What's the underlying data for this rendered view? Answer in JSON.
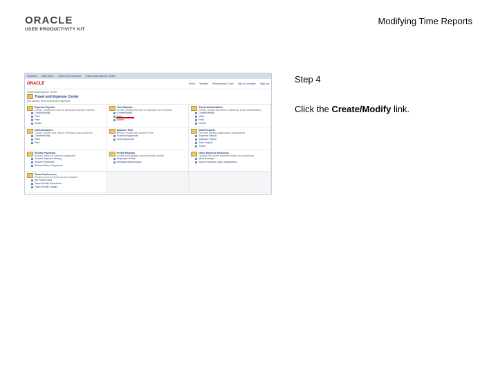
{
  "logo": {
    "brand": "ORACLE",
    "product": "USER PRODUCTIVITY KIT"
  },
  "doc_title": "Modifying Time Reports",
  "step": "Step 4",
  "instruction": {
    "prefix": "Click the ",
    "target": "Create/Modify",
    "suffix": " link."
  },
  "screenshot": {
    "topbar": [
      "Favorites",
      "Main Menu",
      "Travel and Expenses",
      "Travel and Expense Center"
    ],
    "oracle": "ORACLE",
    "nav": [
      "Home",
      "Worklist",
      "Performance Trace",
      "Add to Favorites",
      "Sign out"
    ],
    "crumb": "Travel and Expense Center",
    "center_title": "Travel and Expense Center",
    "intro": "Get started: Select and enter expenses",
    "sections": [
      {
        "name": "Expense Reports",
        "desc": "Create, modify and view or withdraw Expense Reports",
        "links": [
          "Create/Modify",
          "View",
          "Print",
          "Delete"
        ]
      },
      {
        "name": "Time Reports",
        "desc": "Create, modify and view or withdraw Time Reports",
        "links": [
          "Create/Modify",
          "View",
          "Delete"
        ]
      },
      {
        "name": "Travel Authorization",
        "desc": "Create, modify and view or withdraw Travel Authorization",
        "links": [
          "Create/Modify",
          "View",
          "Print",
          "Delete"
        ]
      },
      {
        "name": "Cash Advances",
        "desc": "Create, modify, and view or withdraw cash advances",
        "links": [
          "Create/Modify",
          "View",
          "Print"
        ]
      },
      {
        "name": "Approve Time",
        "desc": "Review, modify and approve time",
        "links": [
          "Expense Approvals",
          "Time Approvals"
        ]
      },
      {
        "name": "Work Reports",
        "desc": "Run and display organization transactions",
        "links": [
          "Expense Report",
          "Advance Report",
          "Time Report",
          "Travel"
        ]
      },
      {
        "name": "Review Payments",
        "desc": "Review history of expense payments",
        "links": [
          "Review Expense History",
          "Review Payments",
          "Review Return Payments"
        ]
      },
      {
        "name": "Profile Registry",
        "desc": "Create and manage expense profile details",
        "links": [
          "Employee Profile",
          "Delegate Authorization"
        ]
      },
      {
        "name": "Other Expense Functions",
        "desc": "Upload and create expense entries for processing",
        "links": [
          "View Receipts",
          "Import Expense Card Transactions"
        ]
      },
      {
        "name": "Travel Preferences",
        "desc": "Review travel preferences and defaults",
        "links": [
          "My Preferences",
          "Travel Profile Selections",
          "Travel Profile Details"
        ]
      }
    ]
  }
}
